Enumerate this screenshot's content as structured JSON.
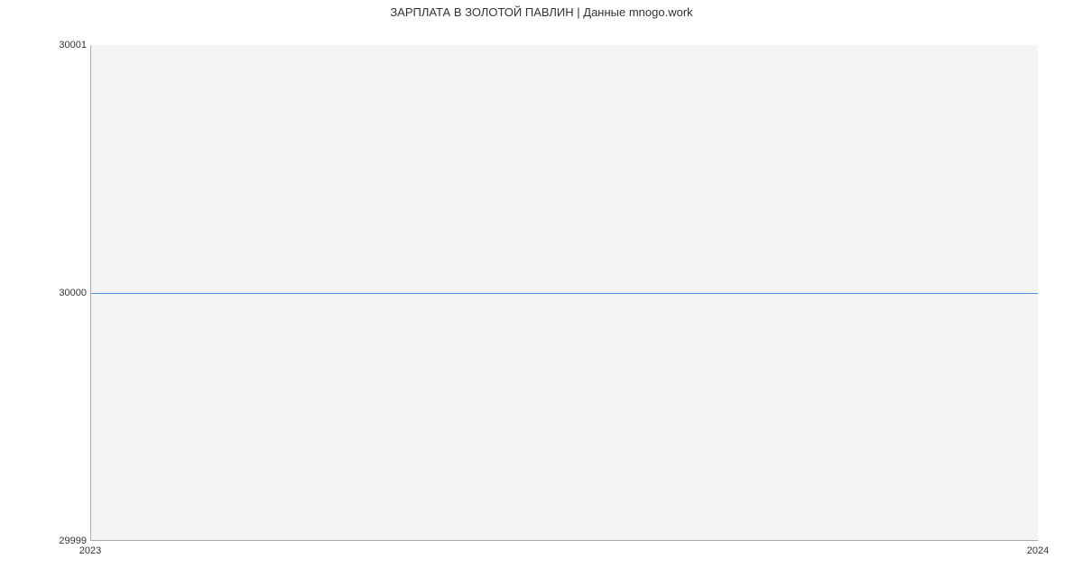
{
  "chart_data": {
    "type": "line",
    "title": "ЗАРПЛАТА В ЗОЛОТОЙ ПАВЛИН | Данные mnogo.work",
    "xlabel": "",
    "ylabel": "",
    "x": [
      "2023",
      "2024"
    ],
    "values": [
      30000,
      30000
    ],
    "ylim": [
      29999,
      30001
    ],
    "xlim": [
      "2023",
      "2024"
    ],
    "y_ticks": [
      "29999",
      "30000",
      "30001"
    ],
    "x_ticks": [
      "2023",
      "2024"
    ],
    "line_color": "#4a90e2",
    "plot_bg": "#f4f4f4"
  }
}
